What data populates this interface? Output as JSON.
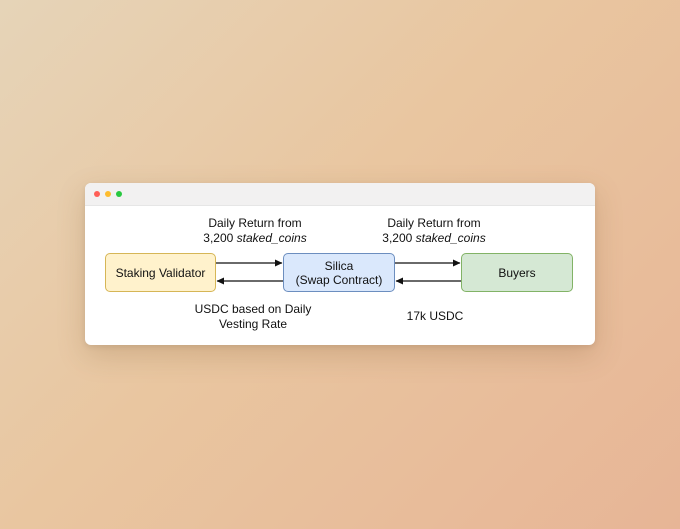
{
  "diagram": {
    "nodes": {
      "validator": "Staking Validator",
      "silica": "Silica\n(Swap Contract)",
      "buyers": "Buyers"
    },
    "edges": {
      "validator_to_silica": {
        "line1": "Daily Return from",
        "line2_prefix": "3,200 ",
        "line2_italic": "staked_coins"
      },
      "silica_to_buyers": {
        "line1": "Daily Return from",
        "line2_prefix": "3,200 ",
        "line2_italic": "staked_coins"
      },
      "silica_to_validator": {
        "line1": "USDC based on Daily",
        "line2": "Vesting Rate"
      },
      "buyers_to_silica": {
        "line1": "17k USDC"
      }
    },
    "colors": {
      "validator_fill": "#fff2cc",
      "validator_stroke": "#d6b656",
      "silica_fill": "#dae8fc",
      "silica_stroke": "#6c8ebf",
      "buyers_fill": "#d5e8d4",
      "buyers_stroke": "#82b366"
    }
  }
}
